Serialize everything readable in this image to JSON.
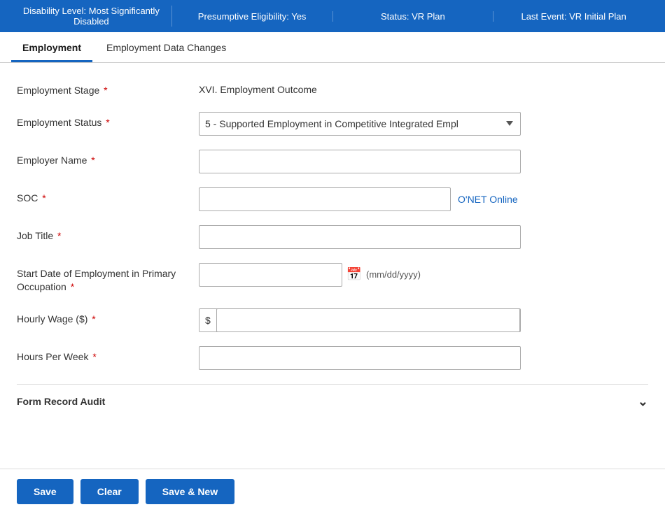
{
  "statusBar": {
    "items": [
      {
        "id": "disability",
        "label": "Disability Level: Most Significantly Disabled"
      },
      {
        "id": "eligibility",
        "label": "Presumptive Eligibility: Yes"
      },
      {
        "id": "status",
        "label": "Status: VR Plan"
      },
      {
        "id": "lastEvent",
        "label": "Last Event: VR Initial Plan"
      }
    ]
  },
  "tabs": [
    {
      "id": "employment",
      "label": "Employment",
      "active": true
    },
    {
      "id": "employment-data-changes",
      "label": "Employment Data Changes",
      "active": false
    }
  ],
  "form": {
    "employmentStage": {
      "label": "Employment Stage",
      "required": true,
      "value": "XVI. Employment Outcome"
    },
    "employmentStatus": {
      "label": "Employment Status",
      "required": true,
      "value": "5 - Supported Employment in Competitive Integrated Empl",
      "options": [
        "5 - Supported Employment in Competitive Integrated Empl"
      ]
    },
    "employerName": {
      "label": "Employer Name",
      "required": true,
      "placeholder": "",
      "value": ""
    },
    "soc": {
      "label": "SOC",
      "required": true,
      "placeholder": "",
      "value": "",
      "onetLink": "O'NET Online"
    },
    "jobTitle": {
      "label": "Job Title",
      "required": true,
      "placeholder": "",
      "value": ""
    },
    "startDate": {
      "label": "Start Date of Employment in Primary Occupation",
      "required": true,
      "placeholder": "",
      "value": "",
      "formatHint": "(mm/dd/yyyy)"
    },
    "hourlyWage": {
      "label": "Hourly Wage ($)",
      "required": true,
      "prefix": "$",
      "value": ""
    },
    "hoursPerWeek": {
      "label": "Hours Per Week",
      "required": true,
      "value": ""
    }
  },
  "auditSection": {
    "label": "Form Record Audit"
  },
  "buttons": {
    "save": "Save",
    "clear": "Clear",
    "saveAndNew": "Save & New"
  }
}
